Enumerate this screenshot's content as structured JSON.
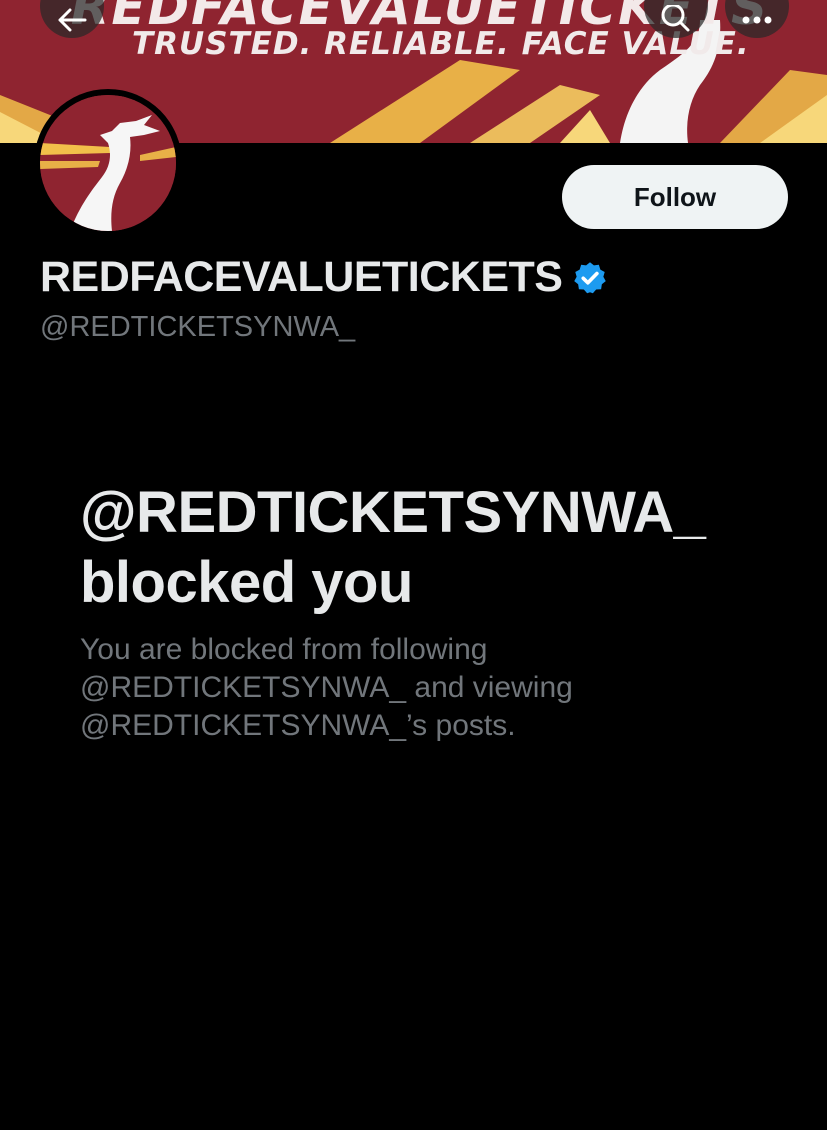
{
  "banner": {
    "title": "REDFACEVALUETICKETS",
    "tagline": "TRUSTED. RELIABLE. FACE VALUE."
  },
  "nav": {
    "back_icon": "arrow-left-icon",
    "search_icon": "search-icon",
    "more_icon": "more-horizontal-icon"
  },
  "profile": {
    "display_name": "REDFACEVALUETICKETS",
    "handle": "@REDTICKETSYNWA_",
    "verified": true,
    "follow_label": "Follow"
  },
  "blocked": {
    "title_line1": "@REDTICKETSYNWA_",
    "title_line2": "blocked you",
    "description": "You are blocked from following @REDTICKETSYNWA_ and viewing @REDTICKETSYNWA_’s posts."
  },
  "colors": {
    "background": "#000000",
    "banner_red": "#8f2430",
    "gold": "#f2c04a",
    "text_primary": "#e7e9ea",
    "text_secondary": "#71767b",
    "verified_blue": "#1d9bf0",
    "follow_bg": "#eff3f4"
  }
}
